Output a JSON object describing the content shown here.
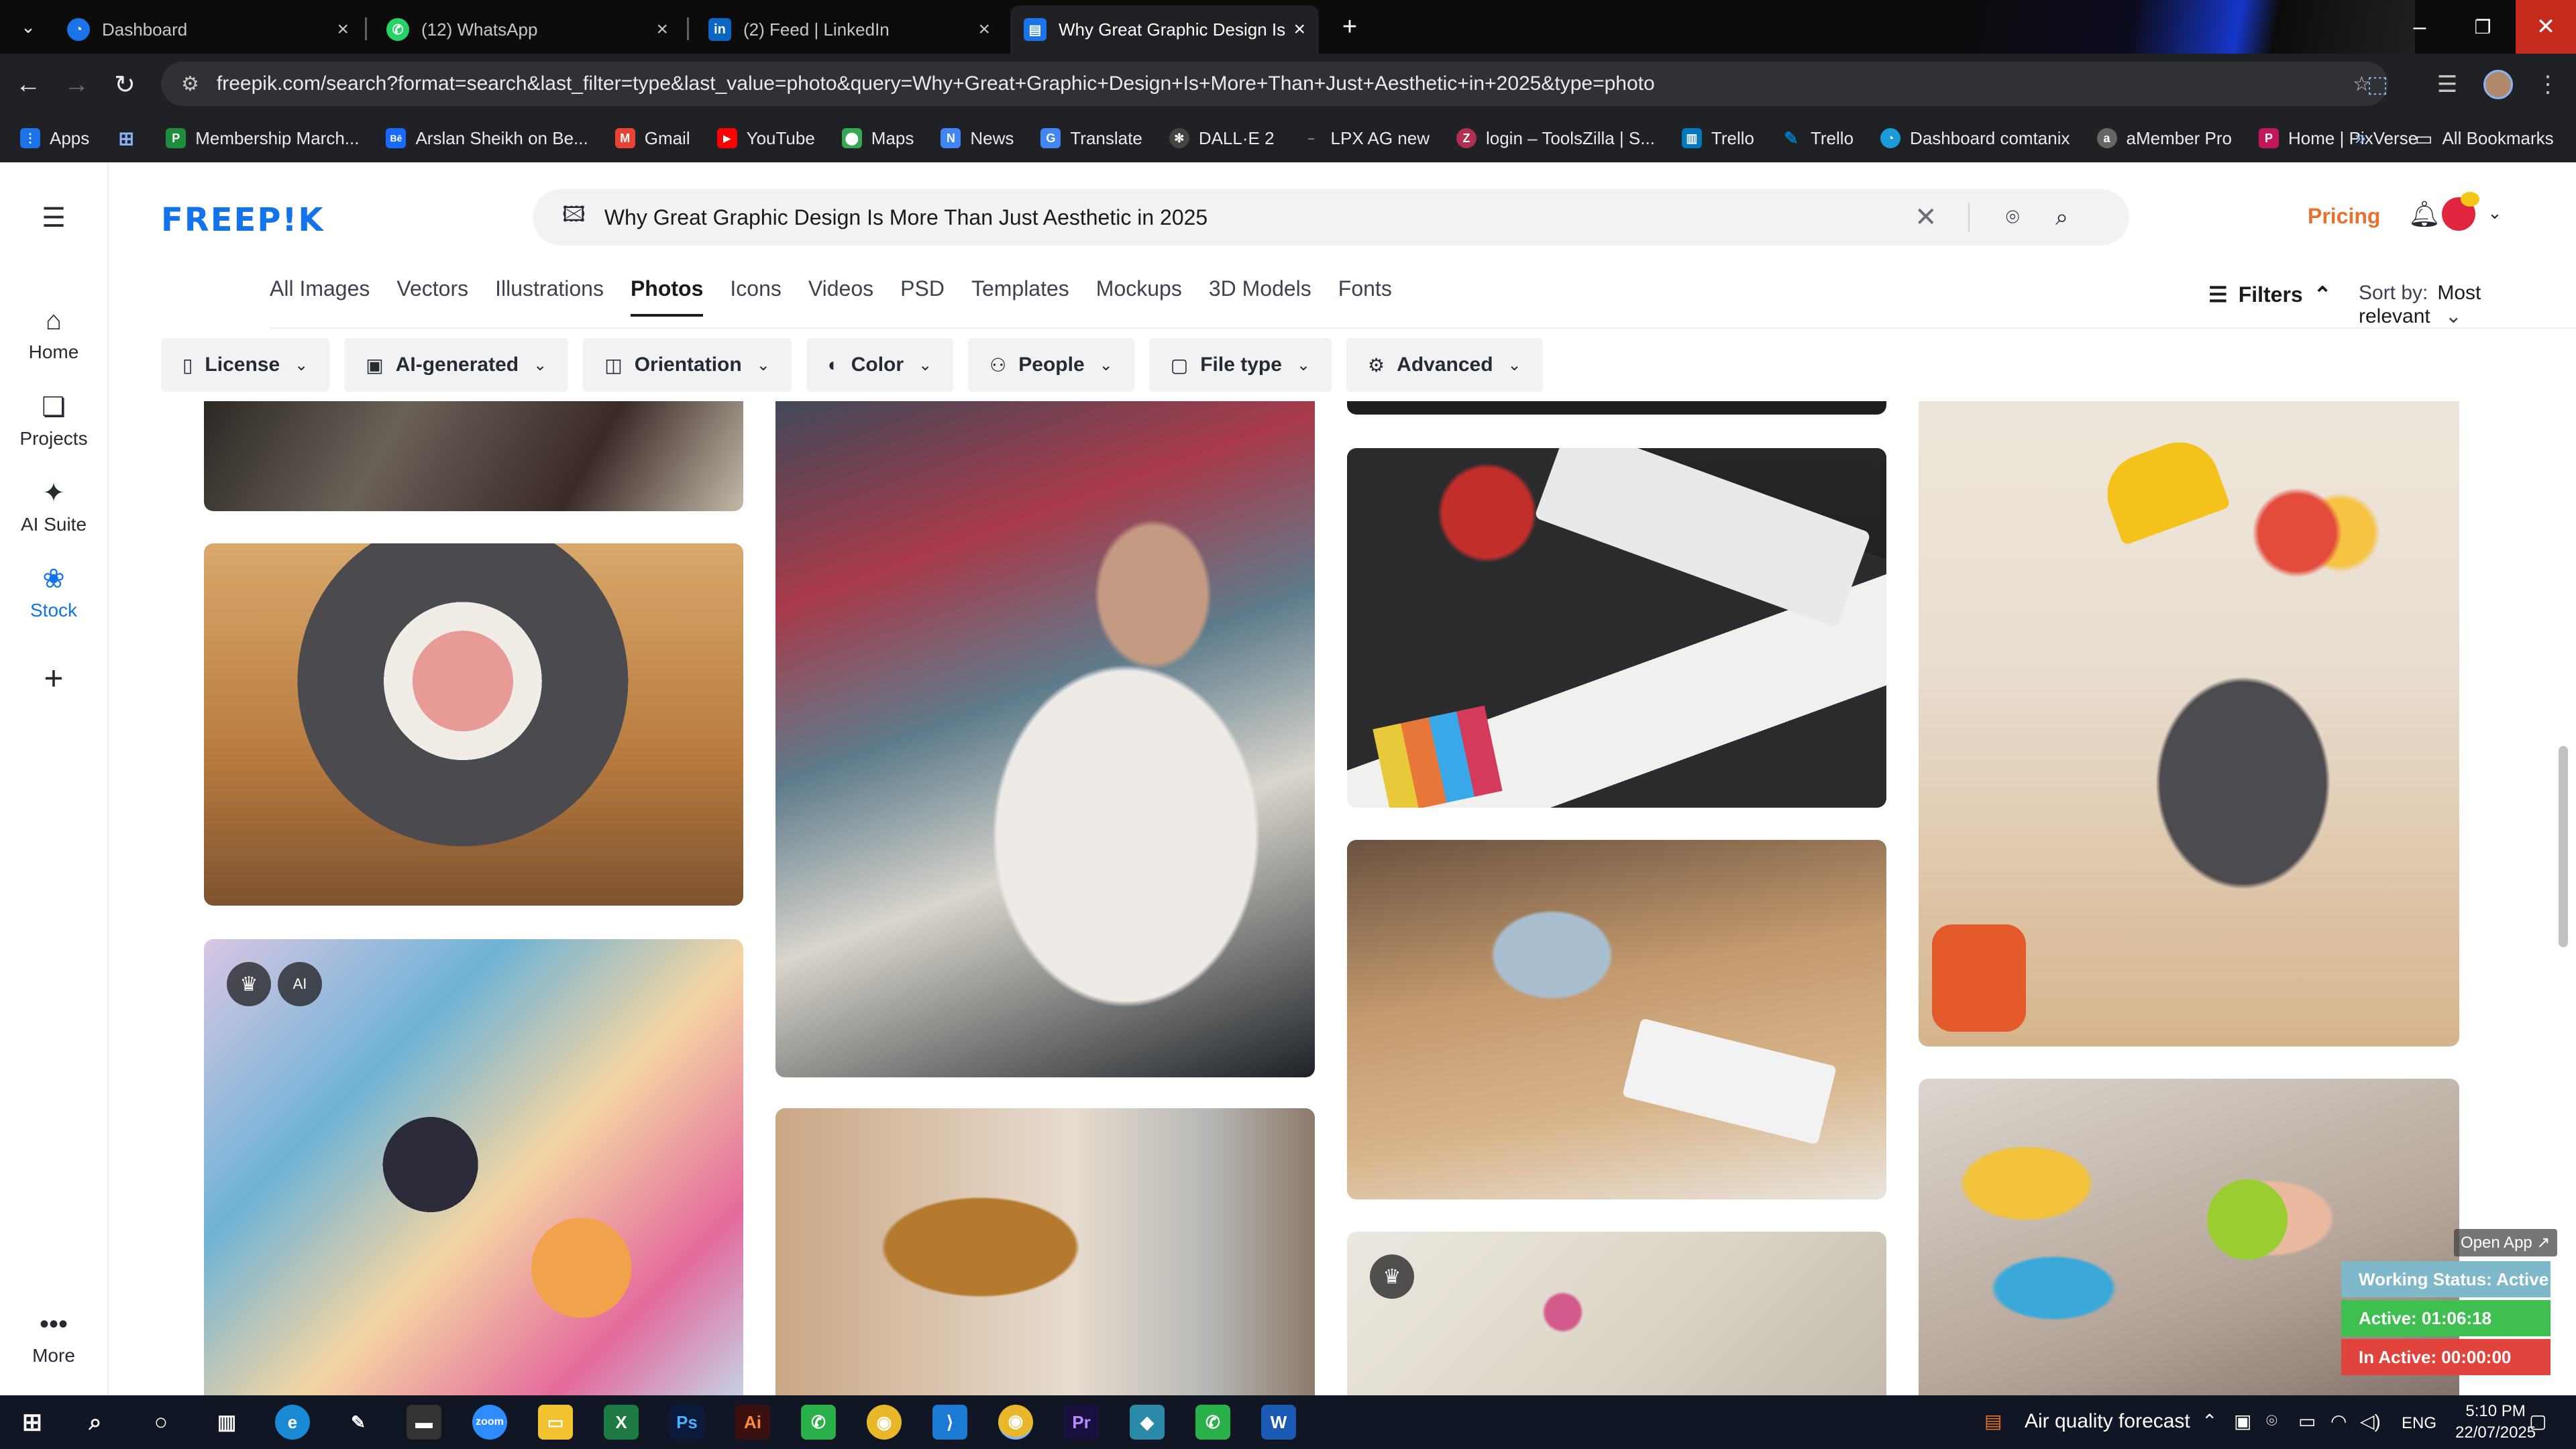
{
  "browser": {
    "tabs": [
      {
        "label": "Dashboard",
        "icon": "gauge-icon",
        "color": "#1a73e8"
      },
      {
        "label": "(12) WhatsApp",
        "icon": "whatsapp-icon",
        "color": "#25d366"
      },
      {
        "label": "(2) Feed | LinkedIn",
        "icon": "linkedin-icon",
        "color": "#0a66c2"
      },
      {
        "label": "Why Great Graphic Design Is M",
        "icon": "doc-icon",
        "color": "#1a73e8"
      }
    ],
    "url": "freepik.com/search?format=search&last_filter=type&last_value=photo&query=Why+Great+Graphic+Design+Is+More+Than+Just+Aesthetic+in+2025&type=photo",
    "bookmarks": [
      {
        "label": "Apps",
        "icon": "apps-grid-icon",
        "color": "#1a73e8"
      },
      {
        "label": "Membership March...",
        "icon": "bookmark-icon",
        "color": "#1e8e3e"
      },
      {
        "label": "Arslan Sheikh on Be...",
        "icon": "behance-icon",
        "color": "#1769ff"
      },
      {
        "label": "Gmail",
        "icon": "gmail-icon",
        "color": "#ea4335"
      },
      {
        "label": "YouTube",
        "icon": "youtube-icon",
        "color": "#ff0000"
      },
      {
        "label": "Maps",
        "icon": "map-pin-icon",
        "color": "#34a853"
      },
      {
        "label": "News",
        "icon": "news-icon",
        "color": "#4285f4"
      },
      {
        "label": "Translate",
        "icon": "translate-icon",
        "color": "#4285f4"
      },
      {
        "label": "DALL·E 2",
        "icon": "openai-icon",
        "color": "#444444"
      },
      {
        "label": "LPX AG new",
        "icon": "dash-icon",
        "color": "#202124"
      },
      {
        "label": "login – ToolsZilla | S...",
        "icon": "toolszilla-icon",
        "color": "#b03050"
      },
      {
        "label": "Trello",
        "icon": "trello-icon",
        "color": "#0079bf"
      },
      {
        "label": "Trello",
        "icon": "trello-icon",
        "color": "#0079bf"
      },
      {
        "label": "Dashboard comtanix",
        "icon": "gauge-icon",
        "color": "#1a9bd7"
      },
      {
        "label": "aMember Pro",
        "icon": "amember-icon",
        "color": "#666666"
      },
      {
        "label": "Home | PixVerse",
        "icon": "pixverse-icon",
        "color": "#c2185b"
      }
    ],
    "all_bookmarks": "All Bookmarks"
  },
  "freepik": {
    "logo": "FREEP!K",
    "rail": [
      {
        "label": "Home",
        "icon": "home-icon"
      },
      {
        "label": "Projects",
        "icon": "projects-icon"
      },
      {
        "label": "AI Suite",
        "icon": "sparkle-icon"
      },
      {
        "label": "Stock",
        "icon": "stock-icon"
      },
      {
        "label": "",
        "icon": "plus-icon"
      },
      {
        "label": "More",
        "icon": "more-dots-icon"
      }
    ],
    "search_query": "Why Great Graphic Design Is More Than Just Aesthetic in 2025",
    "pricing": "Pricing",
    "categories": [
      "All Images",
      "Vectors",
      "Illustrations",
      "Photos",
      "Icons",
      "Videos",
      "PSD",
      "Templates",
      "Mockups",
      "3D Models",
      "Fonts"
    ],
    "active_category": "Photos",
    "filters_label": "Filters",
    "sort_label": "Sort by:",
    "sort_value": "Most relevant",
    "filter_chips": [
      {
        "label": "License",
        "icon": "license-icon"
      },
      {
        "label": "AI-generated",
        "icon": "ai-icon"
      },
      {
        "label": "Orientation",
        "icon": "orientation-icon"
      },
      {
        "label": "Color",
        "icon": "palette-icon"
      },
      {
        "label": "People",
        "icon": "people-icon"
      },
      {
        "label": "File type",
        "icon": "file-icon"
      },
      {
        "label": "Advanced",
        "icon": "settings-icon"
      }
    ]
  },
  "widget": {
    "open_app": "Open App ↗",
    "status": "Working Status: Active",
    "active": "Active: 01:06:18",
    "inactive": "In Active: 00:00:00"
  },
  "taskbar": {
    "weather": "Air quality forecast",
    "lang": "ENG",
    "time": "5:10 PM",
    "date": "22/07/2025"
  }
}
